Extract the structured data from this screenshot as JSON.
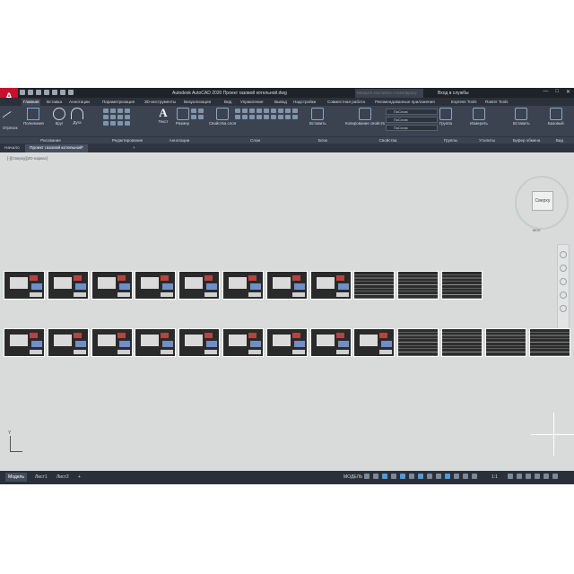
{
  "app": {
    "title": "Autodesk AutoCAD 2020  Проект газовой котельной.dwg",
    "logo_letter": "A",
    "search_placeholder": "Введите ключевое слово/фразу",
    "login": "Вход в службы",
    "window_controls": [
      "—",
      "□",
      "✕"
    ]
  },
  "ribbon_tabs": [
    "Главная",
    "Вставка",
    "Аннотации",
    "Параметризация",
    "3D-инструменты",
    "Визуализация",
    "Вид",
    "Управление",
    "Вывод",
    "Надстройки",
    "Совместная работа",
    "Рекомендованные приложения",
    "Express Tools",
    "Raster Tools"
  ],
  "ribbon": {
    "draw_tools": [
      "Отрезок",
      "Полилиния",
      "Круг",
      "Дуга"
    ],
    "text_tools": [
      "Текст",
      "Размер"
    ],
    "layers_tool": "Свойства слоя",
    "insert_tool": "Вставить",
    "match_props_tool": "Копирование свойств",
    "groups_tool": "Группа",
    "measure_tool": "Измерить",
    "paste_tool": "Вставить",
    "base_tool": "Базовый",
    "property_values": [
      "ПоСлою",
      "ПоСлою",
      "ПоСлою"
    ],
    "panels": [
      "Рисование",
      "Редактирование",
      "Аннотации",
      "Слои",
      "Блок",
      "Свойства",
      "Группы",
      "Утилиты",
      "Буфер обмена",
      "Вид"
    ]
  },
  "doc_tabs": [
    "Начало",
    "Проект газовой котельной*",
    "+"
  ],
  "canvas": {
    "view_label": "[-][Сверху][2D-каркас]",
    "viewcube_face": "Сверху",
    "wcs_label": "МСК",
    "ucs_axis": "Y",
    "row1_sheets": [
      "drawing",
      "drawing",
      "drawing",
      "drawing",
      "drawing",
      "drawing",
      "drawing",
      "drawing",
      "table",
      "table",
      "table"
    ],
    "row2_sheets": [
      "drawing",
      "drawing",
      "drawing",
      "drawing",
      "drawing",
      "drawing",
      "drawing",
      "drawing",
      "drawing",
      "table",
      "table",
      "table",
      "table"
    ]
  },
  "status": {
    "layout_tabs": [
      "Модель",
      "Лист1",
      "Лист2",
      "+"
    ],
    "model_label": "МОДЕЛЬ",
    "scale": "1:1"
  },
  "colors": {
    "titlebar": "#1e2329",
    "ribbon": "#3b4351",
    "canvas": "#d8dbd9",
    "logo": "#c8102e"
  }
}
